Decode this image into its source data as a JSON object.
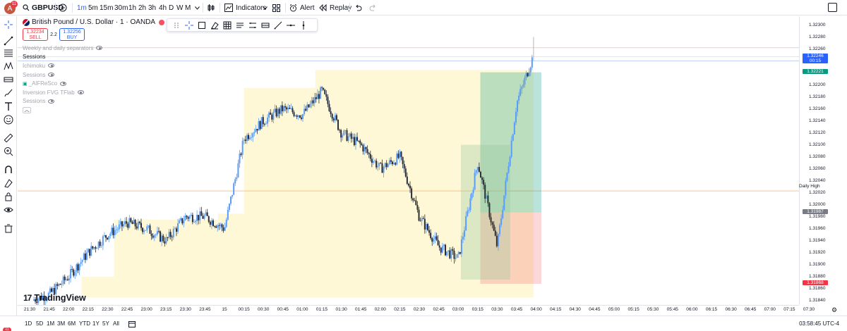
{
  "header": {
    "avatar_letter": "A",
    "notification_count": "11",
    "symbol": "GBPUSD",
    "timeframes": [
      "1m",
      "5m",
      "15m",
      "30m",
      "1h",
      "2h",
      "3h",
      "4h",
      "D",
      "W",
      "M"
    ],
    "active_timeframe": "1m",
    "indicators_label": "Indicators",
    "alert_label": "Alert",
    "replay_label": "Replay"
  },
  "legend": {
    "title": "British Pound / U.S. Dollar · 1 · OANDA",
    "sell_price": "1.32234",
    "sell_label": "SELL",
    "spread": "2.2",
    "buy_price": "1.32256",
    "buy_label": "BUY"
  },
  "indicators": [
    {
      "label": "Weekly and daily separators",
      "muted": true
    },
    {
      "label": "Sessions",
      "muted": false
    },
    {
      "label": "Ichimoku",
      "muted": true
    },
    {
      "label": "Sessions",
      "muted": true
    },
    {
      "label": "_AlFReSco",
      "muted": true
    },
    {
      "label": "Inversion FVG TFlab",
      "muted": true
    },
    {
      "label": "Sessions",
      "muted": true
    }
  ],
  "left_tools": [
    "crosshair-icon",
    "trendline-icon",
    "fib-icon",
    "pattern-icon",
    "measure-icon",
    "brush-icon",
    "text-icon",
    "emoji-icon",
    "ruler-icon",
    "zoom-icon",
    "magnet-icon",
    "lock-drawing-icon",
    "lock-icon",
    "eye-icon",
    "trash-icon"
  ],
  "draw_tools": [
    "crosshair-icon",
    "rect-select-icon",
    "eraser-icon",
    "grid-icon",
    "list-icon",
    "lines-icon",
    "range-icon",
    "ray-icon",
    "hline-icon",
    "vline-icon"
  ],
  "price_axis": {
    "ticks": [
      "1.32300",
      "1.32280",
      "1.32260",
      "1.32240",
      "1.32220",
      "1.32200",
      "1.32180",
      "1.32160",
      "1.32140",
      "1.32120",
      "1.32100",
      "1.32080",
      "1.32060",
      "1.32040",
      "1.32020",
      "1.32000",
      "1.31980",
      "1.31960",
      "1.31940",
      "1.31920",
      "1.31900",
      "1.31880",
      "1.31860",
      "1.31840"
    ],
    "current_price": "1.32246",
    "countdown": "00:15",
    "target_price": "1.32221",
    "entry_price": "1.31987",
    "stop_price": "1.31868",
    "daily_high_label": "Daily High",
    "current_color": "#2962ff",
    "target_color": "#089981",
    "entry_color": "#787b86",
    "stop_color": "#f23645"
  },
  "time_axis": [
    "21:30",
    "21:45",
    "22:00",
    "22:15",
    "22:30",
    "22:45",
    "23:00",
    "23:15",
    "23:30",
    "23:45",
    "15",
    "00:15",
    "00:30",
    "00:45",
    "01:00",
    "01:15",
    "01:30",
    "01:45",
    "02:00",
    "02:15",
    "02:30",
    "02:45",
    "03:00",
    "03:15",
    "03:30",
    "03:45",
    "04:00",
    "04:15",
    "04:30",
    "04:45",
    "05:00",
    "05:15",
    "05:30",
    "05:45",
    "06:00",
    "06:15",
    "06:30",
    "06:45",
    "07:00",
    "07:15",
    "07:30"
  ],
  "bottom": {
    "ranges": [
      "1D",
      "5D",
      "1M",
      "3M",
      "6M",
      "YTD",
      "1Y",
      "5Y",
      "All"
    ],
    "clock": "03:58:45 UTC-4",
    "badge": "11"
  },
  "branding": "TradingView",
  "chart_data": {
    "type": "line",
    "title": "British Pound / U.S. Dollar · 1 · OANDA",
    "ylim": [
      1.3184,
      1.323
    ],
    "x": [
      "21:30",
      "21:45",
      "22:00",
      "22:15",
      "22:30",
      "22:45",
      "23:00",
      "23:15",
      "23:30",
      "23:45",
      "00:00",
      "00:15",
      "00:30",
      "00:45",
      "01:00",
      "01:15",
      "01:30",
      "01:45",
      "02:00",
      "02:15",
      "02:30",
      "02:45",
      "03:00",
      "03:15",
      "03:30",
      "03:45",
      "03:58"
    ],
    "series": [
      {
        "values": [
          1.3184,
          1.3185,
          1.3188,
          1.3192,
          1.3195,
          1.3197,
          1.3196,
          1.3194,
          1.3198,
          1.3198,
          1.3196,
          1.3211,
          1.3214,
          1.3216,
          1.3215,
          1.3219,
          1.3212,
          1.321,
          1.3206,
          1.3208,
          1.3198,
          1.3193,
          1.3191,
          1.3207,
          1.3193,
          1.3217,
          1.3225
        ]
      }
    ],
    "zones": {
      "session_high": 1.32225,
      "session_low": 1.31845,
      "daily_high": 1.32023,
      "position_entry": 1.31987,
      "position_target": 1.32221,
      "position_stop": 1.31868
    }
  }
}
